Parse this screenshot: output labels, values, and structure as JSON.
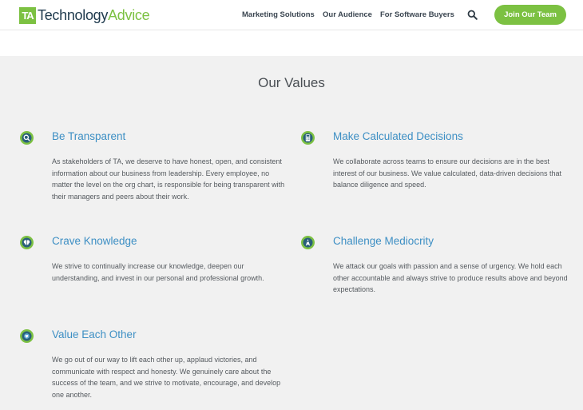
{
  "header": {
    "logo_mark": "TA",
    "logo_tech": "Technology",
    "logo_advice": "Advice",
    "nav": [
      "Marketing Solutions",
      "Our Audience",
      "For Software Buyers"
    ],
    "search_icon": "search-icon",
    "cta_label": "Join Our Team"
  },
  "main": {
    "title": "Our Values",
    "values": [
      {
        "icon": "magnifier-badge-icon",
        "title": "Be Transparent",
        "body": "As stakeholders of TA, we deserve to have honest, open, and consistent information about our business from leadership. Every employee, no matter the level on the org chart, is responsible for being transparent with their managers and peers about their work."
      },
      {
        "icon": "calculator-badge-icon",
        "title": "Make Calculated Decisions",
        "body": "We collaborate across teams to ensure our decisions are in the best interest of our business. We value calculated, data-driven decisions that balance diligence and speed."
      },
      {
        "icon": "brain-badge-icon",
        "title": "Crave Knowledge",
        "body": "We strive to continually increase our knowledge, deepen our understanding, and invest in our personal and professional growth."
      },
      {
        "icon": "target-badge-icon",
        "title": "Challenge Mediocrity",
        "body": "We attack our goals with passion and a sense of urgency. We hold each other accountable and always strive to produce results above and beyond expectations."
      },
      {
        "icon": "heart-badge-icon",
        "title": "Value Each Other",
        "body": "We go out of our way to lift each other up, applaud victories, and communicate with respect and honesty. We genuinely care about the success of the team, and we strive to motivate, encourage, and develop one another."
      }
    ]
  },
  "colors": {
    "brand_green": "#7cc142",
    "brand_navy": "#1f3a4d",
    "value_title_blue": "#3d8fc4",
    "section_bg": "#f1f1f1"
  }
}
